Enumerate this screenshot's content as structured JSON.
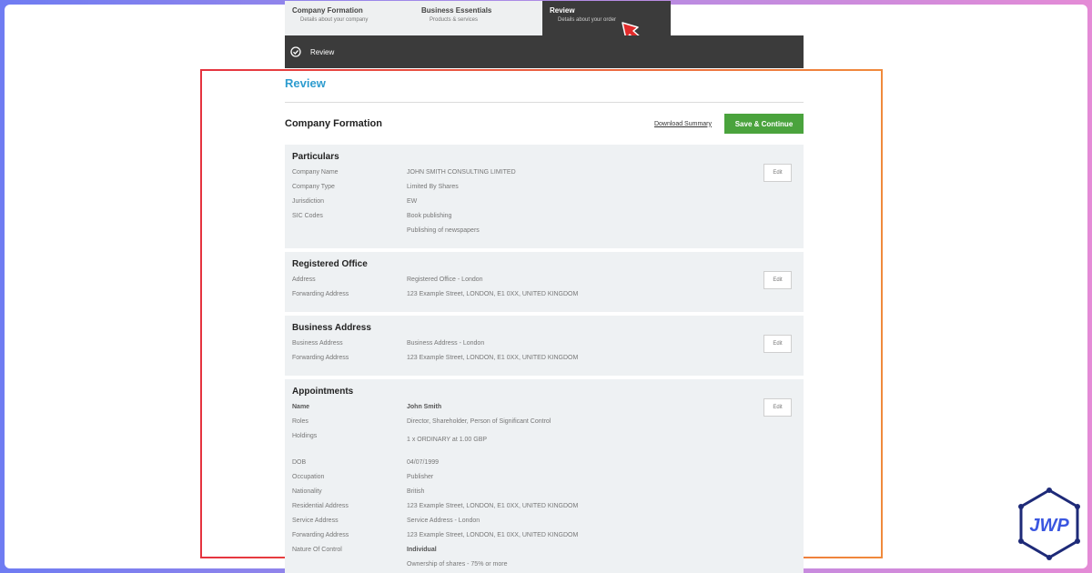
{
  "tabs": [
    {
      "title": "Company Formation",
      "subtitle": "Details about your company"
    },
    {
      "title": "Business Essentials",
      "subtitle": "Products & services"
    },
    {
      "title": "Review",
      "subtitle": "Details about your order"
    }
  ],
  "stepbar": {
    "label": "Review"
  },
  "review_title": "Review",
  "company_formation": {
    "title": "Company Formation",
    "download_label": "Download Summary",
    "save_label": "Save & Continue"
  },
  "edit_label": "Edit",
  "particulars": {
    "title": "Particulars",
    "rows": [
      {
        "k": "Company Name",
        "v": "JOHN SMITH CONSULTING LIMITED"
      },
      {
        "k": "Company Type",
        "v": "Limited By Shares"
      },
      {
        "k": "Jurisdiction",
        "v": "EW"
      },
      {
        "k": "SIC Codes",
        "v": "Book publishing"
      },
      {
        "k": "",
        "v": "Publishing of newspapers"
      }
    ]
  },
  "registered_office": {
    "title": "Registered Office",
    "rows": [
      {
        "k": "Address",
        "v": "Registered Office - London"
      },
      {
        "k": "Forwarding Address",
        "v": "123 Example Street, LONDON, E1 0XX, UNITED KINGDOM"
      }
    ]
  },
  "business_address": {
    "title": "Business Address",
    "rows": [
      {
        "k": "Business Address",
        "v": "Business Address - London"
      },
      {
        "k": "Forwarding Address",
        "v": "123 Example Street, LONDON, E1 0XX, UNITED KINGDOM"
      }
    ]
  },
  "appointments": {
    "title": "Appointments",
    "rows": [
      {
        "k": "Name",
        "v": "John Smith"
      },
      {
        "k": "Roles",
        "v": "Director, Shareholder, Person of Significant Control"
      },
      {
        "k": "Holdings",
        "v": "1 x ORDINARY at 1.00 GBP"
      },
      {
        "k": "DOB",
        "v": "04/07/1999"
      },
      {
        "k": "Occupation",
        "v": "Publisher"
      },
      {
        "k": "Nationality",
        "v": "British"
      },
      {
        "k": "Residential Address",
        "v": "123 Example Street, LONDON, E1 0XX, UNITED KINGDOM"
      },
      {
        "k": "Service Address",
        "v": "Service Address - London"
      },
      {
        "k": "Forwarding Address",
        "v": "123 Example Street, LONDON, E1 0XX, UNITED KINGDOM"
      },
      {
        "k": "Nature Of Control",
        "v": "Individual"
      },
      {
        "k": "",
        "v": "Ownership of shares - 75% or more"
      }
    ]
  },
  "colors": {
    "accent_blue": "#2e9ccf",
    "save_green": "#4aa33d",
    "frame_red": "#e5333f",
    "frame_orange": "#f08a3c",
    "dark_bar": "#3b3b3b"
  },
  "icons": [
    "check-circle-icon",
    "red-arrow-pointer-icon",
    "jwp-logo-icon"
  ]
}
